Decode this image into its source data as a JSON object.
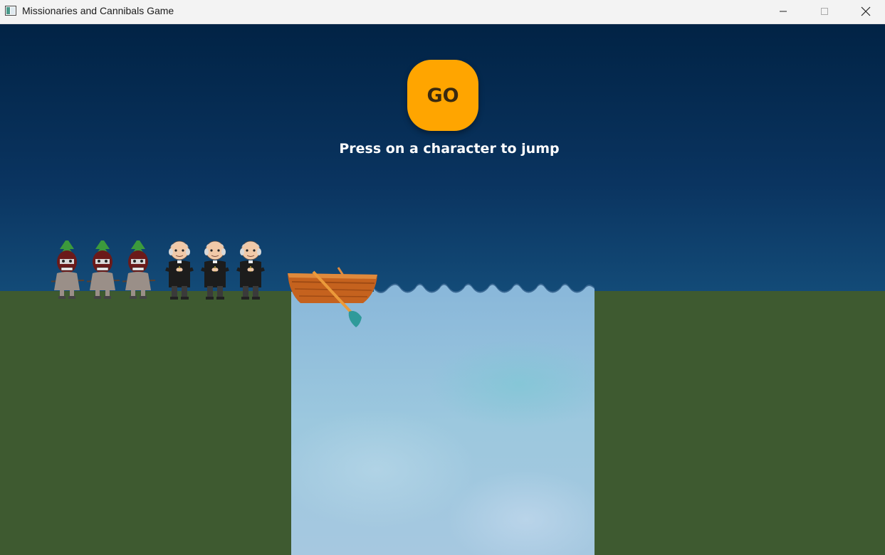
{
  "window": {
    "title": "Missionaries and Cannibals Game",
    "icons": {
      "app": "app-window-icon",
      "minimize": "minimize-icon",
      "maximize": "maximize-icon",
      "close": "close-icon"
    }
  },
  "game": {
    "go_label": "GO",
    "instruction": "Press on a character to jump",
    "left_bank": {
      "cannibals": 3,
      "missionaries": 3
    },
    "boat_side": "left",
    "colors": {
      "go_button": "#ffa500",
      "grass": "#3e5a30",
      "sky_top": "#012345",
      "sky_bottom": "#3a6893",
      "water": "#9cc8de"
    }
  }
}
